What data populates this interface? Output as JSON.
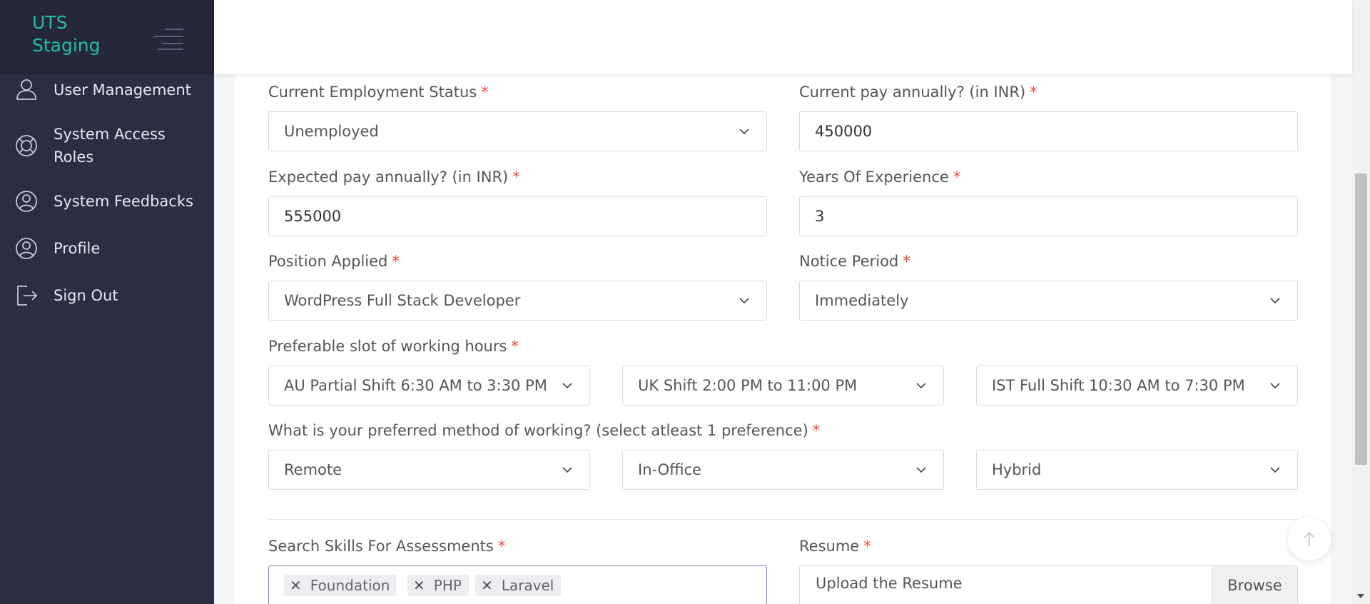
{
  "brand": {
    "line1": "UTS",
    "line2": "Staging"
  },
  "sidebar": {
    "items": [
      {
        "label": "User Management",
        "icon": "user-icon"
      },
      {
        "label_line1": "System Access",
        "label_line2": "Roles",
        "icon": "lifebuoy-icon"
      },
      {
        "label": "System Feedbacks",
        "icon": "user-circle-icon"
      },
      {
        "label": "Profile",
        "icon": "user-circle-icon"
      },
      {
        "label": "Sign Out",
        "icon": "sign-out-icon"
      }
    ]
  },
  "form": {
    "employment_status": {
      "label": "Current Employment Status",
      "value": "Unemployed"
    },
    "current_pay": {
      "label": "Current pay annually? (in INR)",
      "value": "450000"
    },
    "expected_pay": {
      "label": "Expected pay annually? (in INR)",
      "value": "555000"
    },
    "experience": {
      "label": "Years Of Experience",
      "value": "3"
    },
    "position": {
      "label": "Position Applied",
      "value": "WordPress Full Stack Developer"
    },
    "notice": {
      "label": "Notice Period",
      "value": "Immediately"
    },
    "slots": {
      "label": "Preferable slot of working hours",
      "values": [
        "AU Partial Shift 6:30 AM to 3:30 PM",
        "UK Shift 2:00 PM to 11:00 PM",
        "IST Full Shift 10:30 AM to 7:30 PM"
      ]
    },
    "method": {
      "label": "What is your preferred method of working? (select atleast 1 preference)",
      "values": [
        "Remote",
        "In-Office",
        "Hybrid"
      ]
    },
    "skills": {
      "label": "Search Skills For Assessments",
      "tags": [
        "Foundation",
        "PHP",
        "Laravel"
      ]
    },
    "resume": {
      "label": "Resume",
      "placeholder": "Upload the Resume",
      "browse": "Browse"
    },
    "required_mark": "*"
  },
  "colors": {
    "sidebar_bg": "#2b2d42",
    "brand": "#1fbfa0",
    "required": "#e74c3c",
    "focus_border": "#8b7fc7"
  }
}
